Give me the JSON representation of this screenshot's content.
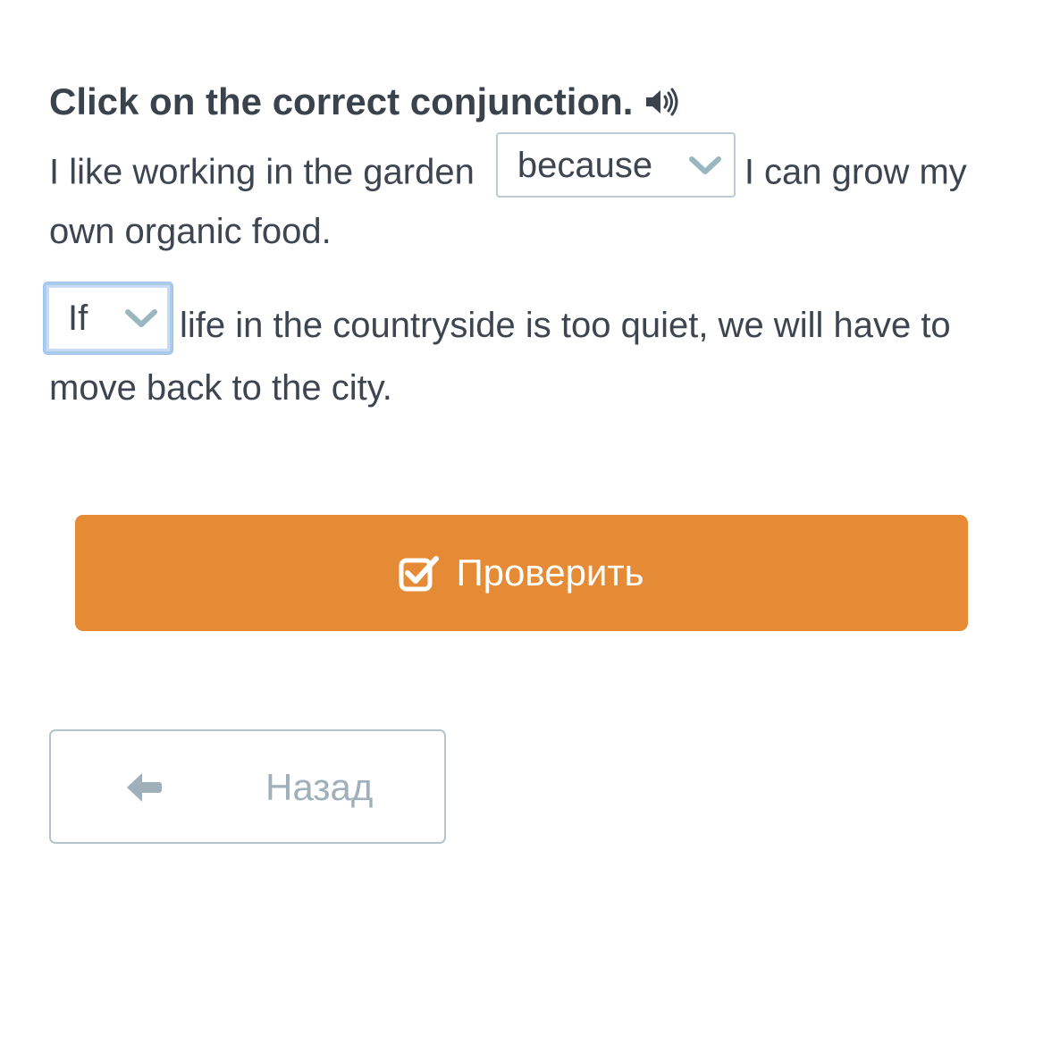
{
  "instruction": {
    "text": "Click on the correct conjunction.",
    "audio_icon": "speaker-icon"
  },
  "sentences": [
    {
      "before": "I like working in the garden",
      "selected": "because",
      "after": "I can grow my own organic food."
    },
    {
      "before": "",
      "selected": "If",
      "after": "life in the countryside is too quiet, we will have to move back to the city."
    }
  ],
  "buttons": {
    "check_label": "Проверить",
    "check_icon": "checkbox-check-icon",
    "back_label": "Назад",
    "back_icon": "arrow-left-icon"
  },
  "colors": {
    "accent": "#e68b35",
    "text": "#3d4550",
    "select_border": "#bccbd3",
    "focus_border": "#aacbea",
    "muted": "#9fb0ba"
  }
}
